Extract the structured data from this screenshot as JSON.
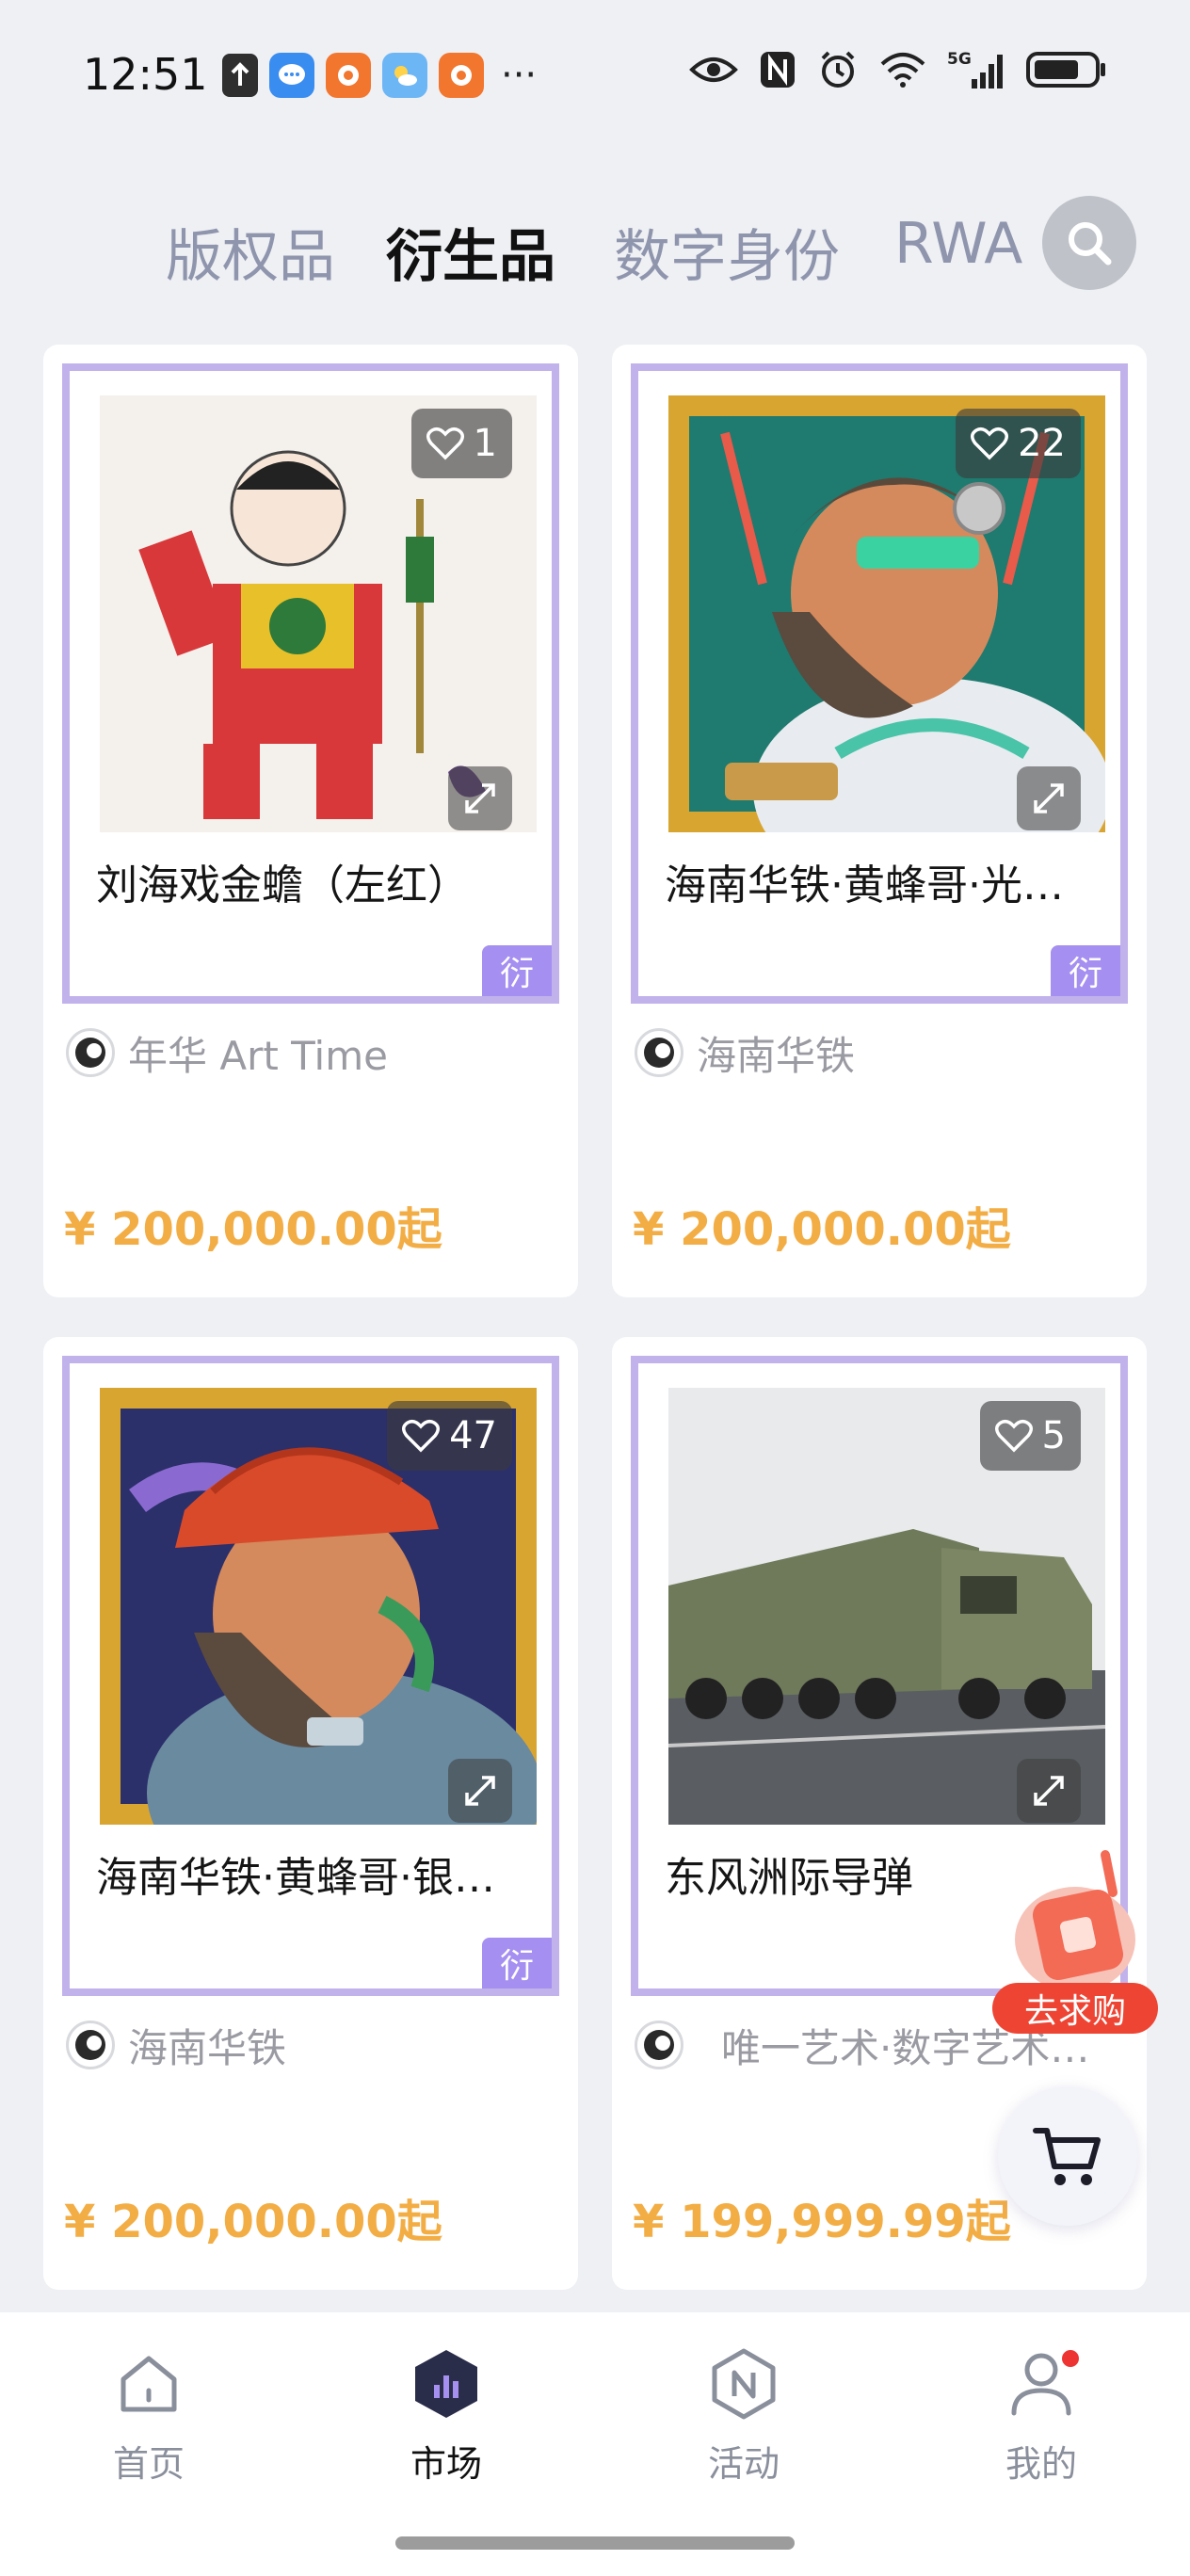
{
  "status_bar": {
    "time": "12:51",
    "left_icons": [
      "upload-icon",
      "message-app-icon",
      "shop-app-icon",
      "weather-app-icon",
      "shop-app-icon"
    ],
    "more": "···",
    "network": "5G",
    "right_icons": [
      "eye-icon",
      "nfc-icon",
      "alarm-icon",
      "wifi-icon",
      "signal-icon",
      "battery-icon"
    ]
  },
  "tabs": [
    {
      "label": "版权品",
      "active": false
    },
    {
      "label": "衍生品",
      "active": true
    },
    {
      "label": "数字身份",
      "active": false
    },
    {
      "label": "RWA",
      "active": false
    }
  ],
  "products": [
    {
      "title": "刘海戏金蟾（左红）",
      "likes": "1",
      "author": "年华 Art Time",
      "price": "¥ 200,000.00起",
      "tag": "衍"
    },
    {
      "title": "海南华铁·黄蜂哥·光…",
      "likes": "22",
      "author": "海南华铁",
      "price": "¥ 200,000.00起",
      "tag": "衍"
    },
    {
      "title": "海南华铁·黄蜂哥·银…",
      "likes": "47",
      "author": "海南华铁",
      "price": "¥ 200,000.00起",
      "tag": "衍"
    },
    {
      "title": "东风洲际导弹",
      "likes": "5",
      "author": "唯一艺术·数字艺术工…",
      "price": "¥ 199,999.99起",
      "tag": ""
    }
  ],
  "floating": {
    "go_buy_label": "去求购"
  },
  "nav": [
    {
      "label": "首页",
      "icon": "home-icon",
      "active": false
    },
    {
      "label": "市场",
      "icon": "market-icon",
      "active": true
    },
    {
      "label": "活动",
      "icon": "activity-icon",
      "active": false
    },
    {
      "label": "我的",
      "icon": "profile-icon",
      "active": false
    }
  ],
  "colors": {
    "accent_price": "#f3ad45",
    "frame": "#c1b2eb",
    "tag": "#a58ff0",
    "active_nav": "#2a2d4a",
    "badge_red": "#ee4433"
  }
}
